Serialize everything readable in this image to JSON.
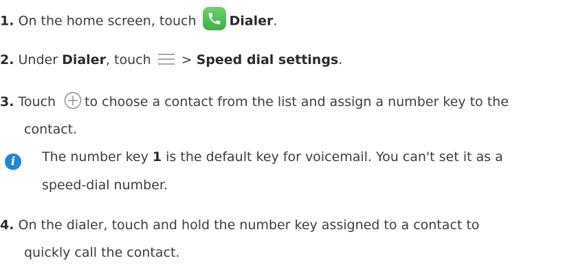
{
  "steps": [
    {
      "number": "1.",
      "lines": [
        {
          "before": "On the home screen, touch",
          "icon": "dialer-app-icon",
          "strong": "Dialer",
          "after": "."
        }
      ]
    },
    {
      "number": "2.",
      "lines": [
        {
          "before": "Under ",
          "strong1": "Dialer",
          "mid": ", touch",
          "icon": "menu-icon",
          "gt": ">",
          "strong2": "Speed dial settings",
          "after": "."
        }
      ]
    },
    {
      "number": "3.",
      "lines": [
        {
          "before": "Touch",
          "icon": "add-circle-icon",
          "after": "to choose a contact from the list and assign a number key to the"
        },
        {
          "text": "contact."
        }
      ]
    },
    {
      "number": "4.",
      "lines": [
        {
          "text": "On the dialer, touch and hold the number key assigned to a contact to"
        },
        {
          "text": "quickly call the contact."
        }
      ]
    }
  ],
  "note": {
    "icon": "info-icon",
    "icon_glyph": "i",
    "line1_before": "The number key ",
    "line1_strong": "1",
    "line1_after": " is the default key for voicemail. You can't set it as a",
    "line2": "speed-dial number."
  },
  "colors": {
    "text": "#3c3c3c",
    "dialer_green": "#4cbe52",
    "info_blue": "#1e88d6",
    "icon_gray": "#8a8a8a"
  }
}
